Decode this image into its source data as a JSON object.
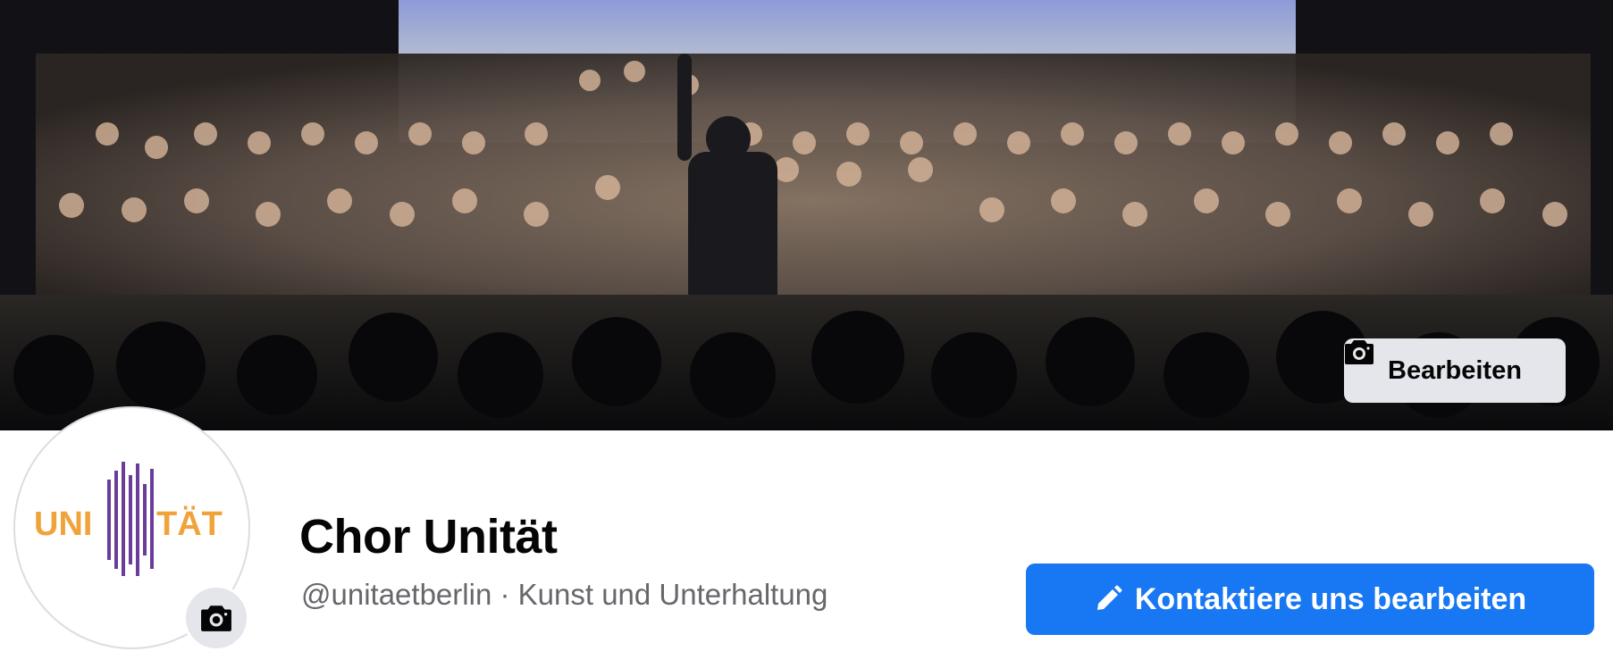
{
  "cover": {
    "edit_button": {
      "label": "Bearbeiten",
      "icon": "camera-icon"
    }
  },
  "profile": {
    "logo_text_left": "UNI",
    "logo_text_right": "TÄT",
    "logo_colors": {
      "text": "#f0a33a",
      "bars": "#6a3d9a"
    },
    "avatar_camera_icon": "camera-icon"
  },
  "page": {
    "name": "Chor Unität",
    "handle": "@unitaetberlin",
    "separator": "·",
    "category": "Kunst und Unterhaltung"
  },
  "actions": {
    "contact_button": {
      "label": "Kontaktiere uns bearbeiten",
      "icon": "pencil-icon"
    }
  },
  "colors": {
    "primary": "#1877f2",
    "secondary_button": "#e4e6eb",
    "meta_text": "#65676b"
  }
}
